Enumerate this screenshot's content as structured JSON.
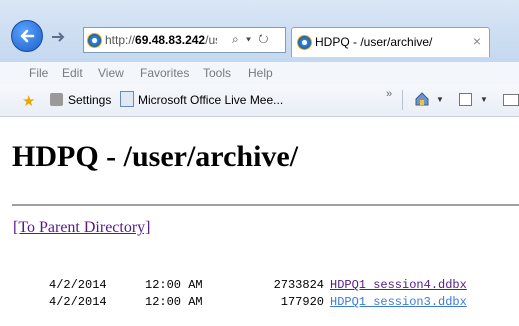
{
  "browser": {
    "address": {
      "prefix": "http://",
      "host": "69.48.83.242",
      "rest": "/user"
    },
    "address_icons": "⌕ ▾ ↻",
    "tab_title": "HDPQ - /user/archive/",
    "tab_close": "×"
  },
  "menu": [
    "File",
    "Edit",
    "View",
    "Favorites",
    "Tools",
    "Help"
  ],
  "favorites": {
    "items": [
      "Settings",
      "Microsoft Office Live Mee..."
    ],
    "overflow": "»"
  },
  "page": {
    "title": "HDPQ - /user/archive/",
    "parent_link": "[To Parent Directory]",
    "files": [
      {
        "date": "4/2/2014",
        "time": "12:00 AM",
        "size": "2733824",
        "name": "HDPQ1 session4.ddbx"
      },
      {
        "date": "4/2/2014",
        "time": "12:00 AM",
        "size": "177920",
        "name": "HDPQ1 session3.ddbx"
      }
    ]
  },
  "colors": {
    "visited_link": "#551a8b",
    "hover_link": "#3b7bd6",
    "accent": "#1c5fc9"
  }
}
